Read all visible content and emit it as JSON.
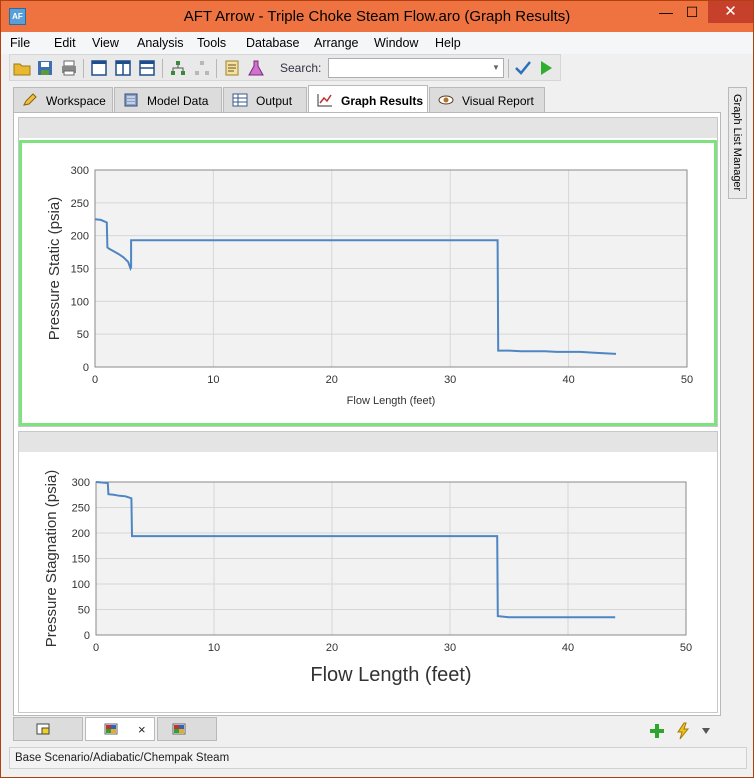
{
  "window": {
    "title": "AFT Arrow - Triple Choke Steam Flow.aro (Graph Results)",
    "app_icon": "aft-arrow-logo-icon",
    "controls": [
      "minimize-icon",
      "maximize-icon",
      "close-icon"
    ]
  },
  "menu": {
    "items": [
      "File",
      "Edit",
      "View",
      "Analysis",
      "Tools",
      "Database",
      "Arrange",
      "Window",
      "Help"
    ]
  },
  "toolbar": {
    "search_label": "Search:",
    "search_value": "",
    "buttons": [
      "open-folder-icon",
      "save-icon",
      "print-icon",
      "layout-single-icon",
      "layout-split-icon",
      "layout-stack-icon",
      "network-icon",
      "network-disabled-icon",
      "checklist-icon",
      "flask-icon",
      "checkmark-icon",
      "run-icon"
    ]
  },
  "tabs": [
    {
      "label": "Workspace",
      "icon": "pencil-icon"
    },
    {
      "label": "Model Data",
      "icon": "model-data-icon"
    },
    {
      "label": "Output",
      "icon": "table-icon"
    },
    {
      "label": "Graph Results",
      "icon": "graph-icon",
      "active": true
    },
    {
      "label": "Visual Report",
      "icon": "eye-icon"
    }
  ],
  "side_panel": {
    "label": "Graph List Manager"
  },
  "graphs": [
    {
      "chart_data": {
        "type": "line",
        "title": "",
        "xlabel": "Flow Length (feet)",
        "ylabel": "Pressure Static (psia)",
        "xlim": [
          0,
          50
        ],
        "ylim": [
          0,
          300
        ],
        "xticks": [
          "0",
          "10",
          "20",
          "30",
          "40",
          "50"
        ],
        "yticks": [
          "0",
          "50",
          "100",
          "150",
          "200",
          "250",
          "300"
        ],
        "grid": true,
        "series": [
          {
            "x": [
              0,
              0.5,
              1.0,
              1.05,
              1.2,
              1.6,
              2.0,
              2.4,
              2.8,
              3.0,
              3.05,
              3.05,
              10,
              20,
              30,
              34.0,
              34.05,
              34.5,
              35,
              36,
              38,
              39,
              40,
              41,
              42,
              43,
              44
            ],
            "y": [
              225,
              224,
              220,
              182,
              180,
              176,
              172,
              167,
              160,
              150,
              152,
              193,
              193,
              193,
              193,
              193,
              25,
              25,
              25,
              24,
              24,
              23,
              23,
              23,
              22,
              21,
              20
            ]
          }
        ]
      }
    },
    {
      "chart_data": {
        "type": "line",
        "title": "",
        "xlabel": "Flow Length (feet)",
        "ylabel": "Pressure Stagnation (psia)",
        "xlim": [
          0,
          50
        ],
        "ylim": [
          0,
          300
        ],
        "xticks": [
          "0",
          "10",
          "20",
          "30",
          "40",
          "50"
        ],
        "yticks": [
          "0",
          "50",
          "100",
          "150",
          "200",
          "250",
          "300"
        ],
        "grid": true,
        "series": [
          {
            "x": [
              0,
              0.5,
              1.0,
              1.05,
              1.5,
              2.0,
              2.5,
              3.0,
              3.05,
              10,
              20,
              30,
              34.0,
              34.05,
              35,
              38,
              40,
              42,
              44
            ],
            "y": [
              300,
              299,
              298,
              276,
              275,
              273,
              272,
              268,
              194,
              194,
              194,
              194,
              194,
              37,
              35,
              35,
              35,
              35,
              35
            ]
          }
        ]
      }
    }
  ],
  "bottom_tabs": [
    {
      "icon": "graph-list-icon"
    },
    {
      "icon": "grid-color-icon",
      "close": "×"
    },
    {
      "icon": "grid-color-icon"
    }
  ],
  "bottom_icons": [
    "add-graph-icon",
    "lightning-icon",
    "dropdown-arrow-icon"
  ],
  "status": {
    "text": "Base Scenario/Adiabatic/Chempak Steam"
  },
  "colors": {
    "title_bar": "#ee7340",
    "close_button": "#c7402c",
    "series_line": "#4e86c3",
    "selected_outline": "#7ee27e"
  }
}
